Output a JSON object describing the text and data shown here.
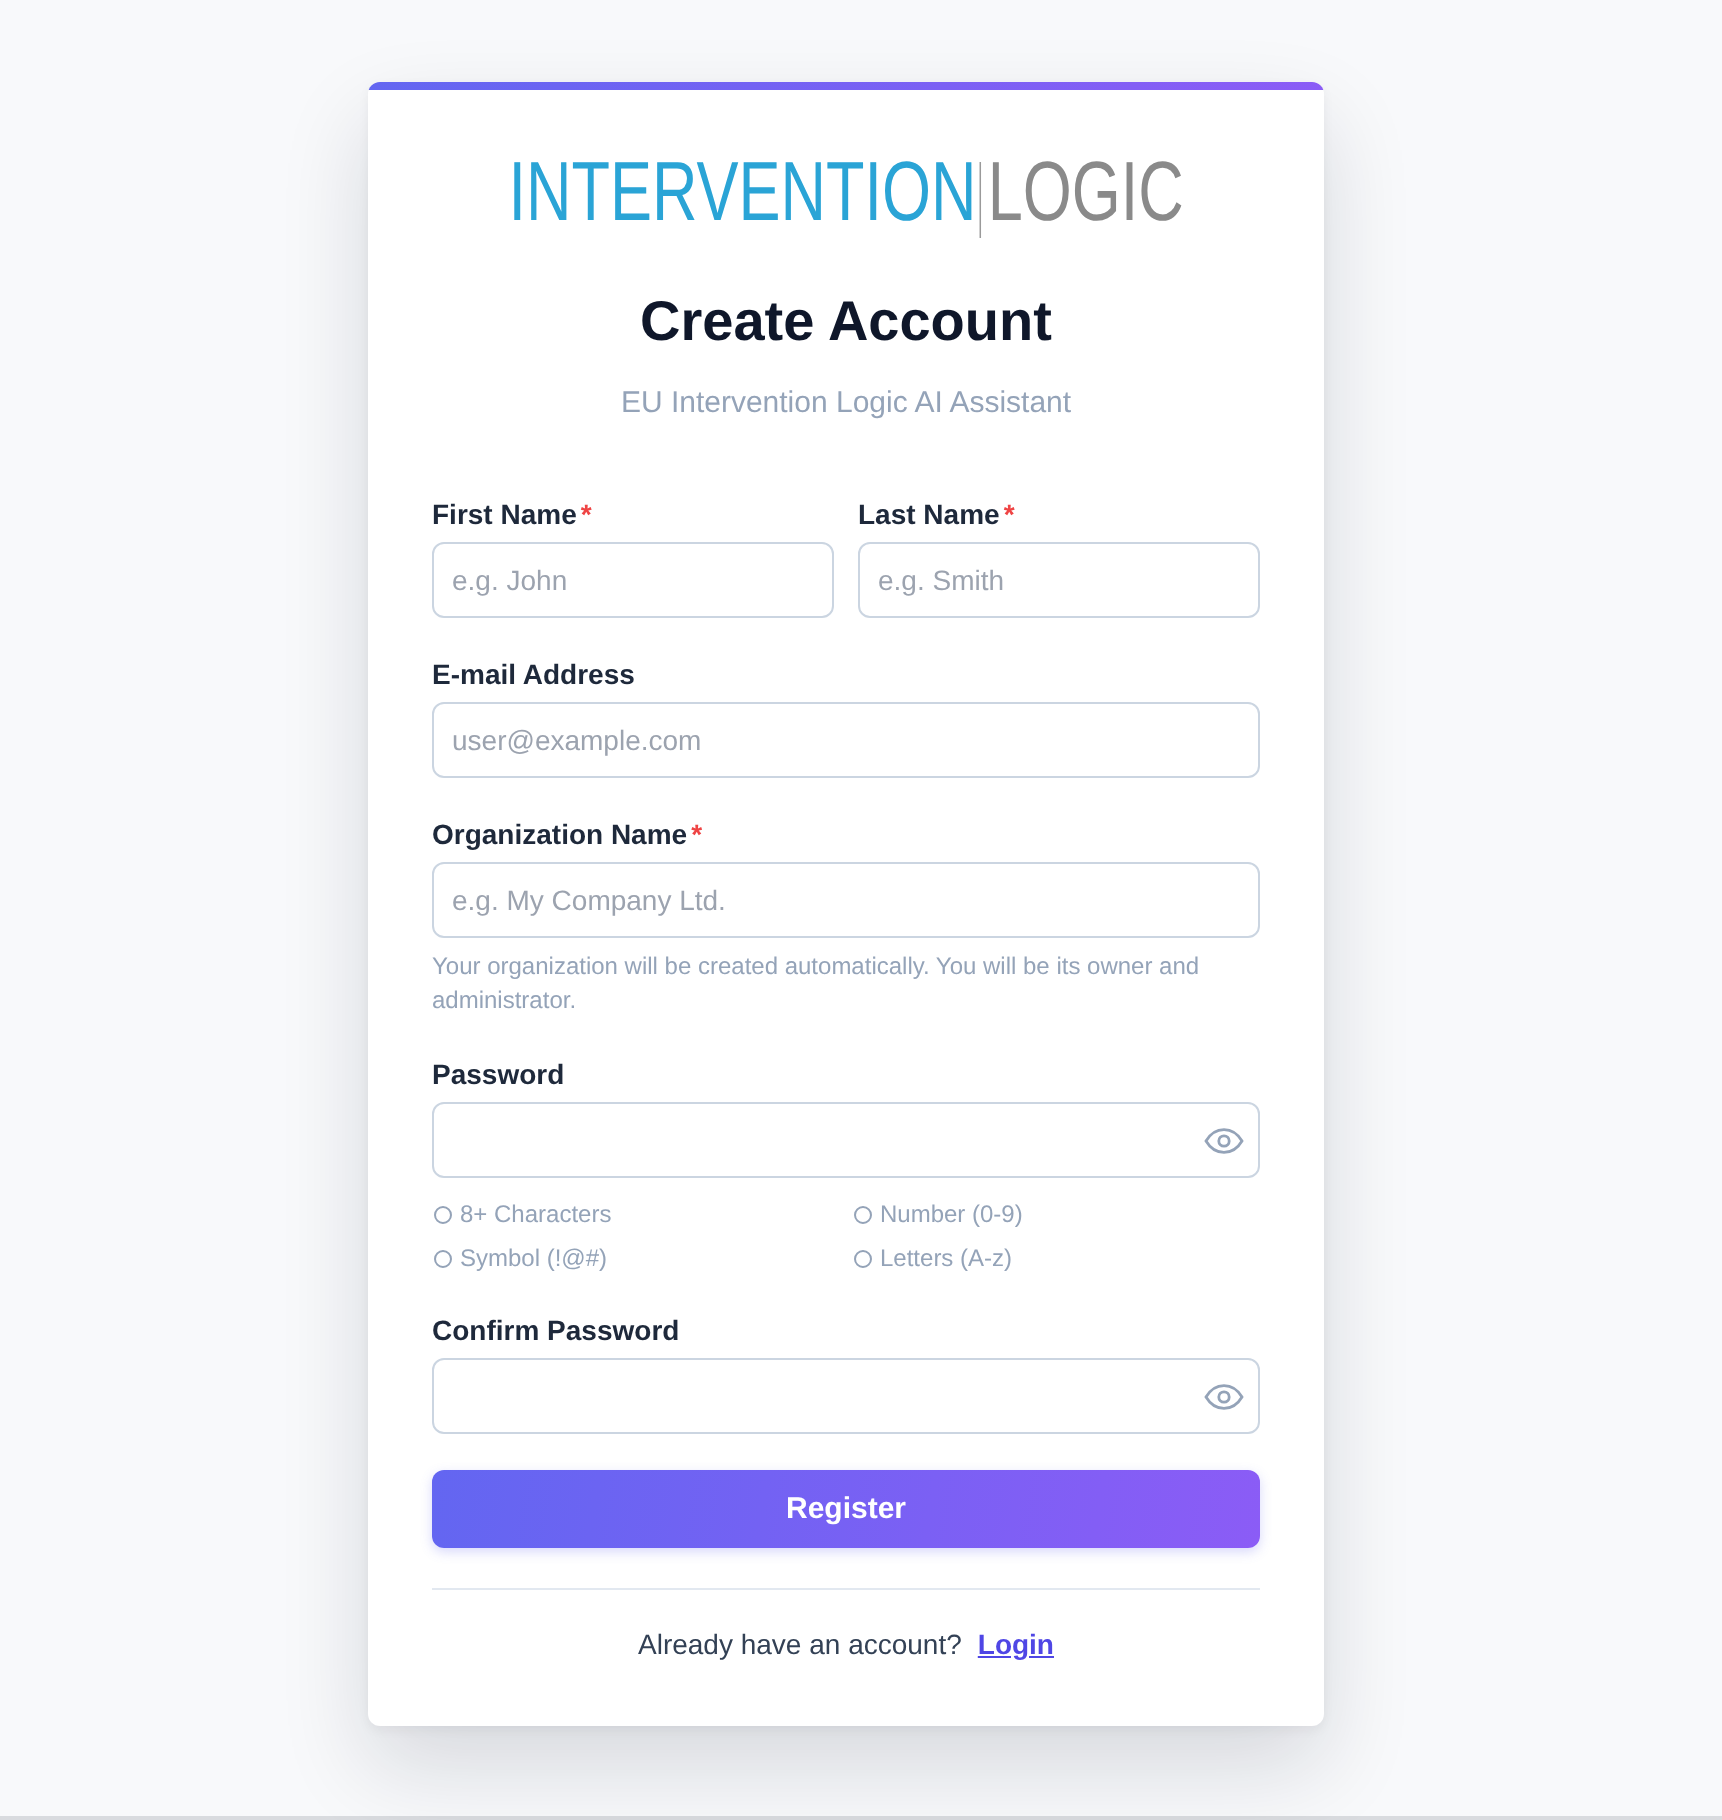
{
  "logo": {
    "primary": "INTERVENTION",
    "secondary": "LOGIC"
  },
  "title": "Create Account",
  "subtitle": "EU Intervention Logic AI Assistant",
  "required_mark": "*",
  "form": {
    "rows": [
      {
        "fields": [
          {
            "label": "First Name",
            "required": true,
            "placeholder": "e.g. John",
            "kind": "text"
          },
          {
            "label": "Last Name",
            "required": true,
            "placeholder": "e.g. Smith",
            "kind": "text"
          }
        ]
      },
      {
        "fields": [
          {
            "label": "E-mail Address",
            "required": false,
            "placeholder": "user@example.com",
            "kind": "text"
          }
        ]
      },
      {
        "fields": [
          {
            "label": "Organization Name",
            "required": true,
            "placeholder": "e.g. My Company Ltd.",
            "kind": "text",
            "hint": "Your organization will be created automatically. You will be its owner and administrator."
          }
        ]
      },
      {
        "fields": [
          {
            "label": "Password",
            "required": false,
            "kind": "password",
            "requirements": [
              {
                "label": "8+ Characters",
                "met": false
              },
              {
                "label": "Number (0-9)",
                "met": false
              },
              {
                "label": "Symbol (!@#)",
                "met": false
              },
              {
                "label": "Letters (A-z)",
                "met": false
              }
            ]
          }
        ]
      },
      {
        "fields": [
          {
            "label": "Confirm Password",
            "required": false,
            "kind": "password"
          }
        ]
      }
    ]
  },
  "submit": "Register",
  "footer": {
    "prompt": "Already have an account?",
    "link": "Login"
  }
}
